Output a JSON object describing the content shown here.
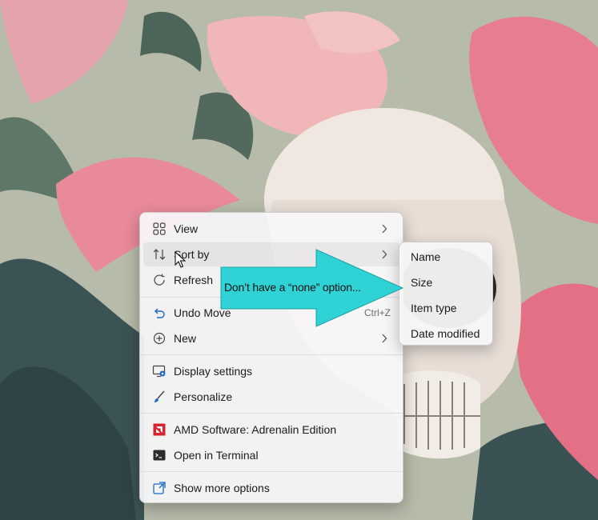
{
  "context_menu": {
    "items": [
      {
        "label": "View",
        "icon": "view-grid-icon",
        "submenu": true
      },
      {
        "label": "Sort by",
        "icon": "sort-arrows-icon",
        "submenu": true,
        "highlighted": true
      },
      {
        "label": "Refresh",
        "icon": "refresh-icon"
      },
      {
        "label": "Undo Move",
        "icon": "undo-icon",
        "shortcut": "Ctrl+Z"
      },
      {
        "label": "New",
        "icon": "new-plus-icon",
        "submenu": true
      },
      {
        "label": "Display settings",
        "icon": "display-settings-icon"
      },
      {
        "label": "Personalize",
        "icon": "personalize-brush-icon"
      },
      {
        "label": "AMD Software: Adrenalin Edition",
        "icon": "amd-logo-icon"
      },
      {
        "label": "Open in Terminal",
        "icon": "terminal-icon"
      },
      {
        "label": "Show more options",
        "icon": "show-more-icon"
      }
    ]
  },
  "sort_submenu": {
    "items": [
      "Name",
      "Size",
      "Item type",
      "Date modified"
    ]
  },
  "annotation": {
    "text": "Don’t have a “none” option...",
    "color": "#2fd3d6"
  },
  "colors": {
    "accent_blue": "#1a67c8",
    "amd_red": "#d7232f",
    "menu_text": "#1b1b1b"
  }
}
